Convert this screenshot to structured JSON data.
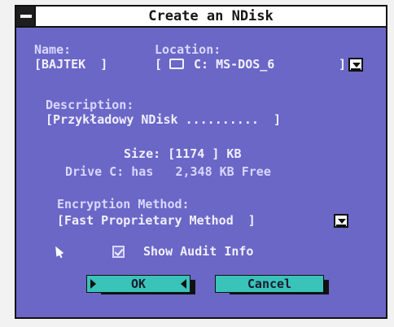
{
  "window": {
    "title": "Create an NDisk"
  },
  "form": {
    "name_label": "Name:",
    "name_value": "[BAJTEK  ]",
    "location_label": "Location:",
    "location_open": "[",
    "location_value": "C: MS-DOS_6",
    "location_close": "]",
    "description_label": "Description:",
    "description_value": "[Przykładowy NDisk ..........  ]",
    "size_line": "Size: [1174 ] KB",
    "drive_line": "Drive C: has   2,348 KB Free",
    "encryption_label": "Encryption Method:",
    "encryption_value": "[Fast Proprietary Method  ]",
    "audit_label": "Show Audit Info"
  },
  "buttons": {
    "ok": "OK",
    "cancel": "Cancel"
  },
  "colors": {
    "dialog_background": "#6a67c6",
    "button_face": "#39c3b9",
    "text": "#f2efff"
  },
  "icons": {
    "system_menu": "system-menu-icon",
    "location_dropdown": "chevron-down-icon",
    "encryption_dropdown": "chevron-down-icon",
    "drive": "drive-icon",
    "checkbox": "checkbox-checked-icon",
    "pointer": "mouse-pointer-icon"
  }
}
